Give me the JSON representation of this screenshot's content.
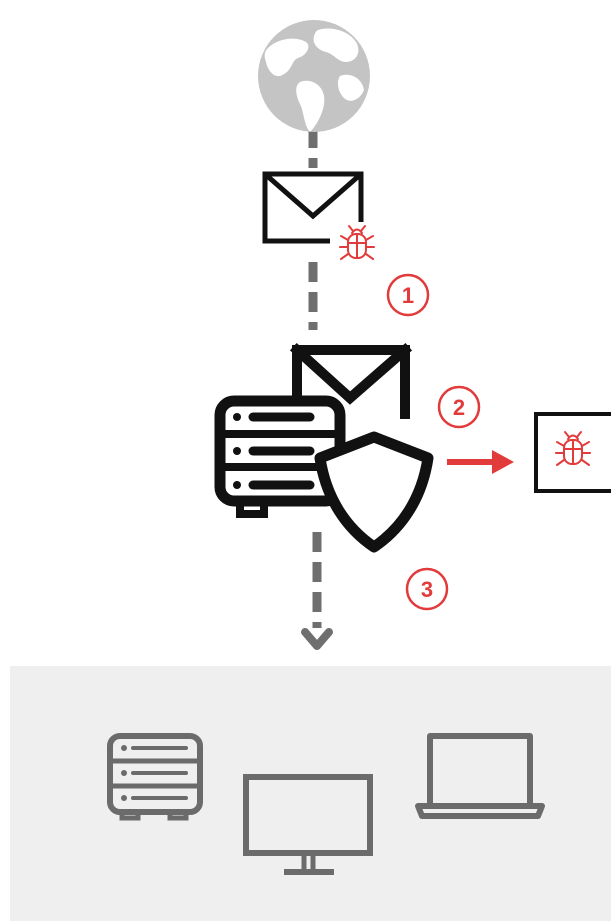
{
  "steps": [
    {
      "number": "1"
    },
    {
      "number": "2"
    },
    {
      "number": "3"
    }
  ],
  "icons": {
    "source": "globe-icon",
    "incoming_mail": "envelope-icon",
    "threat": "bug-icon",
    "gateway": "mail-server-shield-icon",
    "quarantine": "quarantined-bug-icon",
    "destinations": [
      "server-icon",
      "monitor-icon",
      "laptop-icon"
    ]
  },
  "colors": {
    "accent": "#e23b3b",
    "connector": "#6f6f6f",
    "icon_dark": "#111111",
    "icon_gray": "#6b6b6b",
    "globe": "#c4c4c4",
    "panel": "#efefef"
  }
}
